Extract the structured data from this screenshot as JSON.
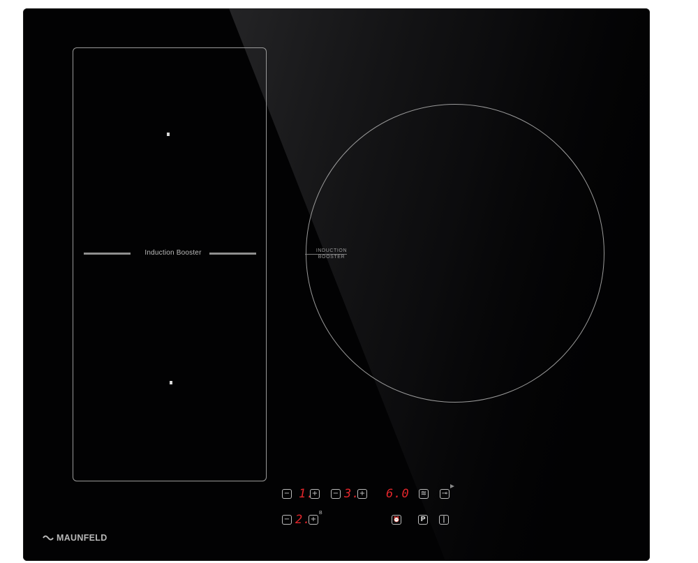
{
  "flex_zone": {
    "label": "Induction Booster"
  },
  "round_zone": {
    "label_line1": "INDUCTION",
    "label_line2": "BOOSTER"
  },
  "controls": {
    "minus": "−",
    "plus": "+",
    "zone1_level": "1.",
    "zone3_level": "3.",
    "timer_display": "6.0",
    "zone2_level": "2.",
    "zone2_superscript": "B",
    "keep_warm_icon": "≋",
    "lock_icon": "⊸",
    "timer_icon": "⏰",
    "pause_label": "P",
    "power_label": "|"
  },
  "brand": {
    "name": "MAUNFELD"
  },
  "colors": {
    "panel": "#020203",
    "display_red": "#e3262b",
    "marking": "#9a9a9a"
  }
}
